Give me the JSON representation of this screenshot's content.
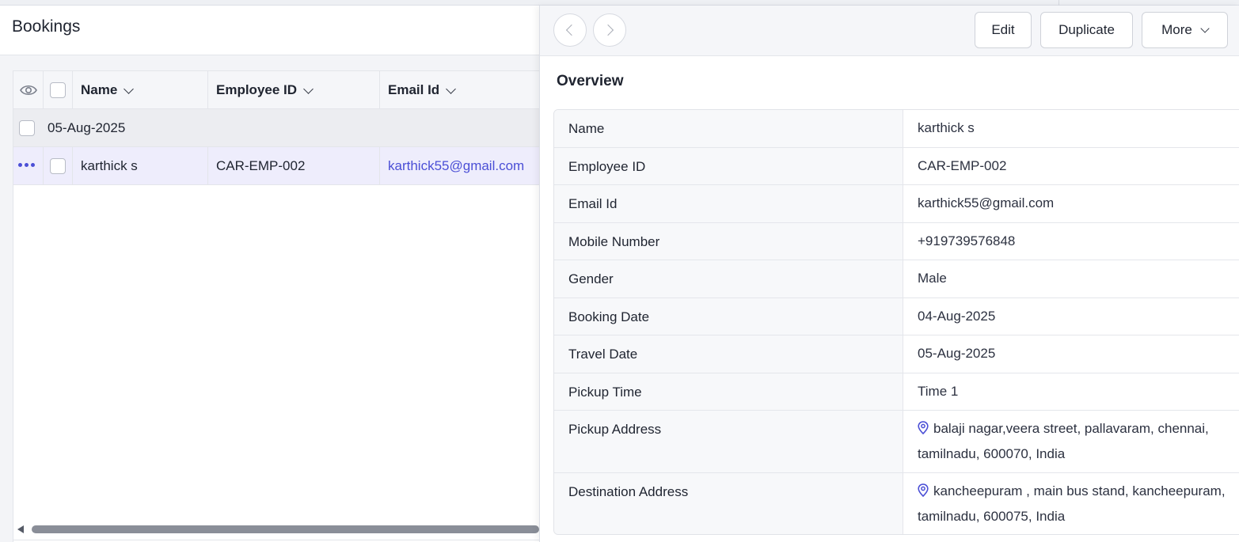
{
  "list_view": {
    "title": "Bookings",
    "columns": [
      {
        "label": "Name"
      },
      {
        "label": "Employee ID"
      },
      {
        "label": "Email Id"
      }
    ],
    "group_label": "05-Aug-2025",
    "rows": [
      {
        "name": "karthick s",
        "employee_id": "CAR-EMP-002",
        "email": "karthick55@gmail.com"
      }
    ]
  },
  "detail": {
    "buttons": {
      "edit": "Edit",
      "duplicate": "Duplicate",
      "more": "More"
    },
    "section_title": "Overview",
    "fields": [
      {
        "label": "Name",
        "value": "karthick s"
      },
      {
        "label": "Employee ID",
        "value": "CAR-EMP-002"
      },
      {
        "label": "Email Id",
        "value": "karthick55@gmail.com"
      },
      {
        "label": "Mobile Number",
        "value": "+919739576848"
      },
      {
        "label": "Gender",
        "value": "Male"
      },
      {
        "label": "Booking Date",
        "value": "04-Aug-2025"
      },
      {
        "label": "Travel Date",
        "value": "05-Aug-2025"
      },
      {
        "label": "Pickup Time",
        "value": "Time 1"
      },
      {
        "label": "Pickup Address",
        "value_line1": "balaji nagar,veera street, pallavaram, chennai,",
        "value_line2": "tamilnadu, 600070, India"
      },
      {
        "label": "Destination Address",
        "value_line1": "kancheepuram , main bus stand, kancheepuram,",
        "value_line2": "tamilnadu, 600075, India"
      }
    ]
  },
  "colors": {
    "accent": "#4b4fd6",
    "row_selected": "#eeedfc"
  }
}
